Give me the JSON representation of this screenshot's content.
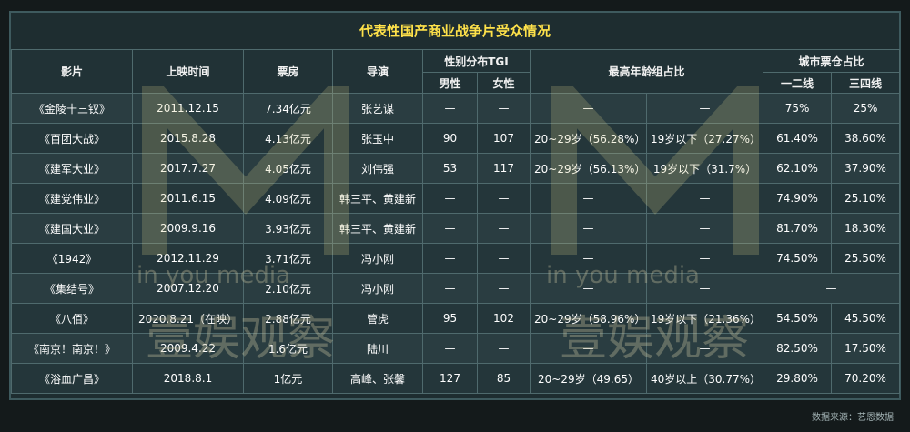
{
  "title": "代表性国产商业战争片受众情况",
  "headers": {
    "film": "影片",
    "release": "上映时间",
    "box": "票房",
    "director": "导演",
    "gender": "性别分布TGI",
    "male": "男性",
    "female": "女性",
    "age": "最高年龄组占比",
    "city": "城市票仓占比",
    "tier12": "一二线",
    "tier34": "三四线"
  },
  "rows": [
    {
      "film": "《金陵十三钗》",
      "release": "2011.12.15",
      "box": "7.34亿元",
      "director": "张艺谋",
      "male": "—",
      "female": "—",
      "age1": "—",
      "age2": "—",
      "t12": "75%",
      "t34": "25%"
    },
    {
      "film": "《百团大战》",
      "release": "2015.8.28",
      "box": "4.13亿元",
      "director": "张玉中",
      "male": "90",
      "female": "107",
      "age1": "20~29岁（56.28%）",
      "age2": "19岁以下（27.27%）",
      "t12": "61.40%",
      "t34": "38.60%"
    },
    {
      "film": "《建军大业》",
      "release": "2017.7.27",
      "box": "4.05亿元",
      "director": "刘伟强",
      "male": "53",
      "female": "117",
      "age1": "20~29岁（56.13%）",
      "age2": "19岁以下（31.7%）",
      "t12": "62.10%",
      "t34": "37.90%"
    },
    {
      "film": "《建党伟业》",
      "release": "2011.6.15",
      "box": "4.09亿元",
      "director": "韩三平、黄建新",
      "male": "—",
      "female": "—",
      "age1": "—",
      "age2": "—",
      "t12": "74.90%",
      "t34": "25.10%"
    },
    {
      "film": "《建国大业》",
      "release": "2009.9.16",
      "box": "3.93亿元",
      "director": "韩三平、黄建新",
      "male": "—",
      "female": "—",
      "age1": "—",
      "age2": "—",
      "t12": "81.70%",
      "t34": "18.30%"
    },
    {
      "film": "《1942》",
      "release": "2012.11.29",
      "box": "3.71亿元",
      "director": "冯小刚",
      "male": "—",
      "female": "—",
      "age1": "—",
      "age2": "—",
      "t12": "74.50%",
      "t34": "25.50%"
    },
    {
      "film": "《集结号》",
      "release": "2007.12.20",
      "box": "2.10亿元",
      "director": "冯小刚",
      "male": "—",
      "female": "—",
      "age1": "—",
      "age2": "—",
      "t12": "—",
      "t34": ""
    },
    {
      "film": "《八佰》",
      "release": "2020.8.21（在映）",
      "box": "2.88亿元",
      "director": "管虎",
      "male": "95",
      "female": "102",
      "age1": "20~29岁（58.96%）",
      "age2": "19岁以下（21.36%）",
      "t12": "54.50%",
      "t34": "45.50%"
    },
    {
      "film": "《南京！南京！》",
      "release": "2009.4.22",
      "box": "1.6亿元",
      "director": "陆川",
      "male": "—",
      "female": "—",
      "age1": "—",
      "age2": "—",
      "t12": "82.50%",
      "t34": "17.50%"
    },
    {
      "film": "《浴血广昌》",
      "release": "2018.8.1",
      "box": "1亿元",
      "director": "高峰、张馨",
      "male": "127",
      "female": "85",
      "age1": "20~29岁（49.65）",
      "age2": "40岁以上（30.77%）",
      "t12": "29.80%",
      "t34": "70.20%"
    }
  ],
  "source": "数据来源：艺恩数据",
  "watermark": {
    "brand": "in you media",
    "cn": "壹娱观察"
  }
}
